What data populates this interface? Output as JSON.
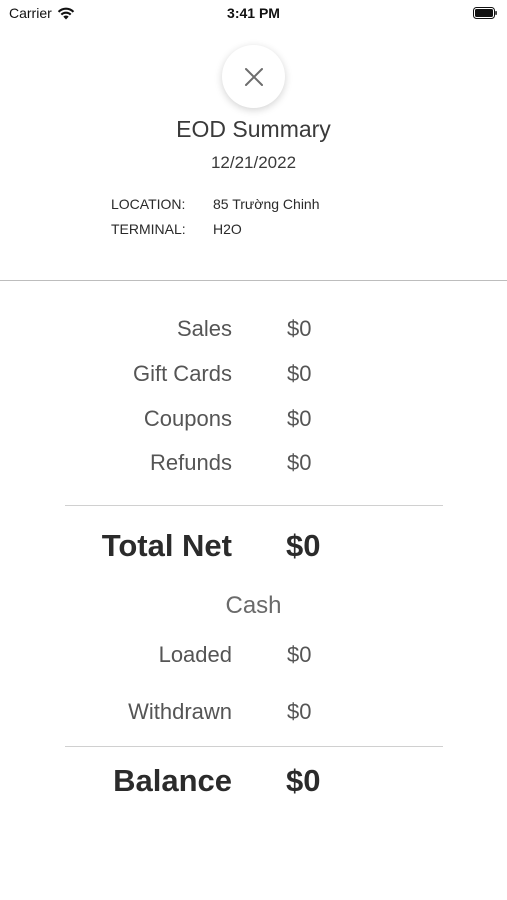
{
  "status_bar": {
    "carrier": "Carrier",
    "time": "3:41 PM"
  },
  "header": {
    "close_icon": "close-icon",
    "title": "EOD Summary",
    "date": "12/21/2022"
  },
  "meta": {
    "location_label": "LOCATION:",
    "location_value": "85 Trường Chinh",
    "terminal_label": "TERMINAL:",
    "terminal_value": "H2O"
  },
  "summary": {
    "lines": [
      {
        "label": "Sales",
        "value": "$0"
      },
      {
        "label": "Gift Cards",
        "value": "$0"
      },
      {
        "label": "Coupons",
        "value": "$0"
      },
      {
        "label": "Refunds",
        "value": "$0"
      }
    ],
    "total_net": {
      "label": "Total Net",
      "value": "$0"
    }
  },
  "cash": {
    "heading": "Cash",
    "lines": [
      {
        "label": "Loaded",
        "value": "$0"
      },
      {
        "label": "Withdrawn",
        "value": "$0"
      }
    ],
    "balance": {
      "label": "Balance",
      "value": "$0"
    }
  },
  "colors": {
    "text_primary": "#2b2b2b",
    "text_secondary": "#555555",
    "divider": "#bdbdbd"
  }
}
